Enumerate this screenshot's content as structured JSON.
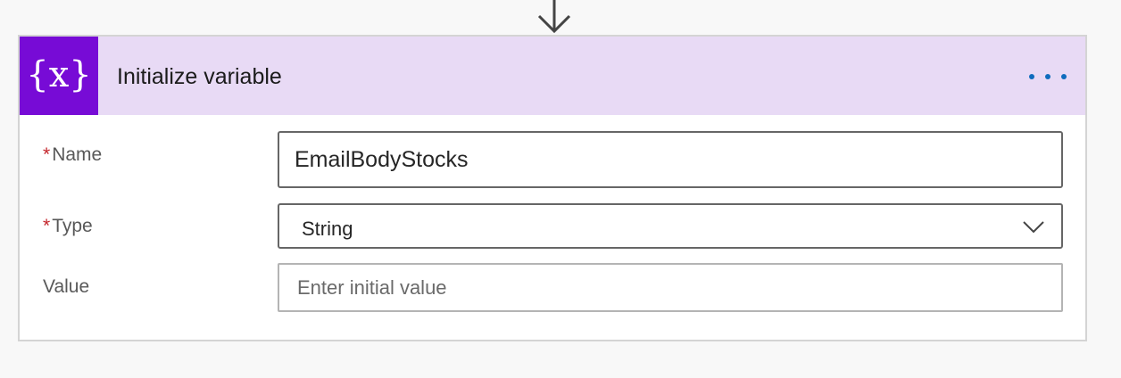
{
  "action": {
    "title": "Initialize variable",
    "icon": "variable-braces-icon",
    "icon_text": "{x}",
    "accent_color": "#770bd6",
    "header_color": "#e8daf5",
    "more_icon": "more-options-icon"
  },
  "form": {
    "name": {
      "required_mark": "*",
      "label": "Name",
      "value": "EmailBodyStocks"
    },
    "type": {
      "required_mark": "*",
      "label": "Type",
      "selected": "String",
      "icon": "chevron-down-icon"
    },
    "value": {
      "label": "Value",
      "placeholder": "Enter initial value",
      "value": ""
    }
  },
  "connector": {
    "icon": "arrow-down-icon"
  }
}
